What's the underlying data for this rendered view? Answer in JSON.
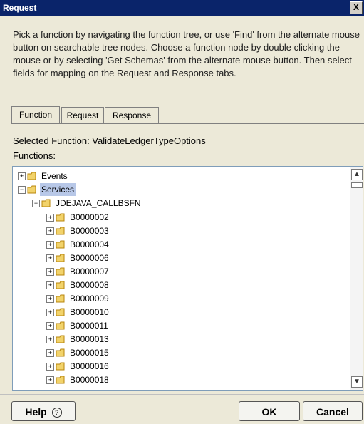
{
  "window": {
    "title": "Request",
    "close_glyph": "X"
  },
  "instructions": "Pick a function by navigating the function tree, or use 'Find' from the alternate mouse button on searchable tree nodes. Choose a function node by double clicking the mouse or by selecting 'Get Schemas' from the alternate mouse button. Then select fields for mapping on the Request and Response tabs.",
  "tabs": [
    {
      "label": "Function"
    },
    {
      "label": "Request"
    },
    {
      "label": "Response"
    }
  ],
  "selected_function": "Selected Function: ValidateLedgerTypeOptions",
  "functions_label": "Functions:",
  "tree": [
    {
      "label": "Events"
    },
    {
      "label": "Services"
    },
    {
      "label": "JDEJAVA_CALLBSFN"
    },
    {
      "label": "B0000002"
    },
    {
      "label": "B0000003"
    },
    {
      "label": "B0000004"
    },
    {
      "label": "B0000006"
    },
    {
      "label": "B0000007"
    },
    {
      "label": "B0000008"
    },
    {
      "label": "B0000009"
    },
    {
      "label": "B0000010"
    },
    {
      "label": "B0000011"
    },
    {
      "label": "B0000013"
    },
    {
      "label": "B0000015"
    },
    {
      "label": "B0000016"
    },
    {
      "label": "B0000018"
    }
  ],
  "buttons": {
    "help": "Help",
    "help_icon": "?",
    "ok": "OK",
    "cancel": "Cancel"
  },
  "colors": {
    "titlebar": "#0a246a",
    "selection": "#b8c8e8",
    "folder": "#f2d36b"
  }
}
